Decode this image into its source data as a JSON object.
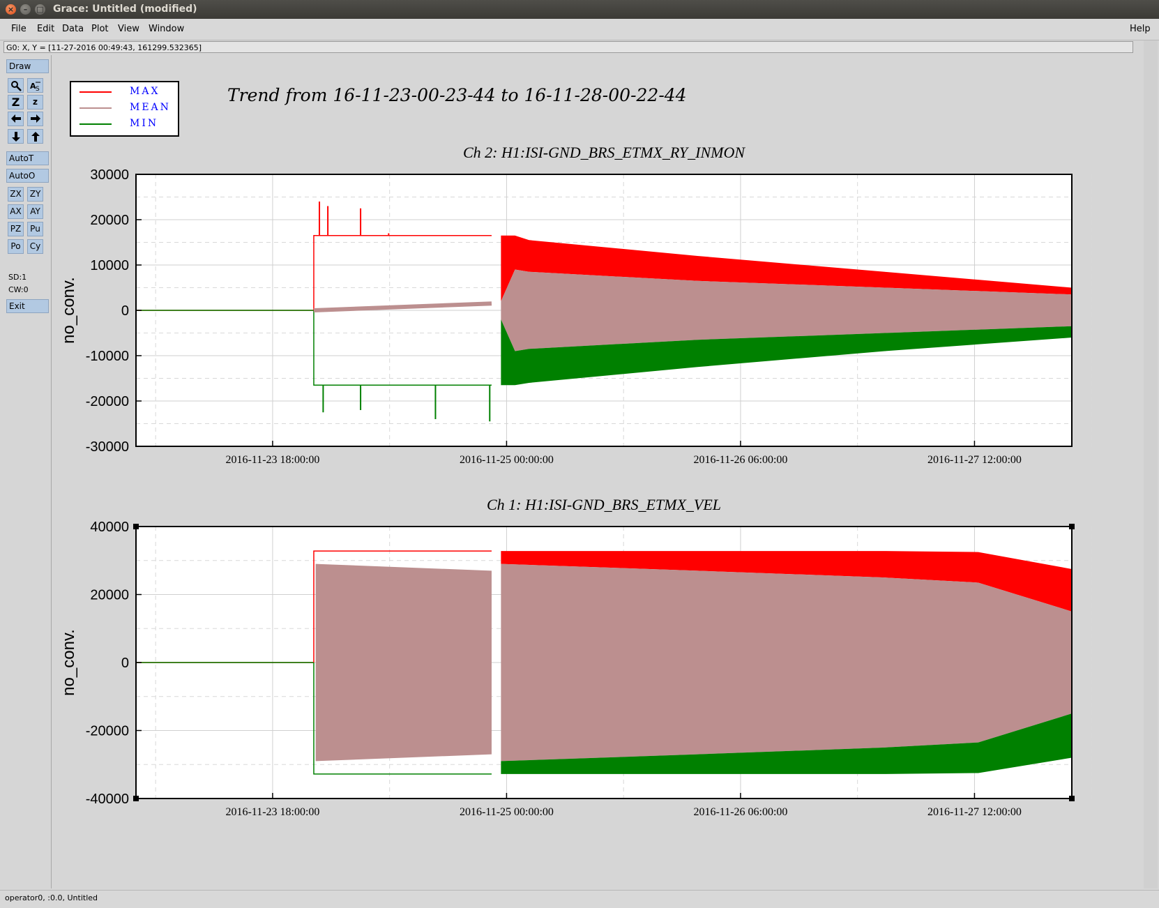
{
  "window": {
    "title": "Grace: Untitled (modified)",
    "close_glyph": "×",
    "min_glyph": "–",
    "max_glyph": "□"
  },
  "menu": {
    "items": [
      "File",
      "Edit",
      "Data",
      "Plot",
      "View",
      "Window"
    ],
    "help": "Help"
  },
  "locator": "G0: X, Y = [11-27-2016 00:49:43, 161299.532365]",
  "toolbox": {
    "draw": "Draw",
    "autot": "AutoT",
    "autoo": "AutoO",
    "zx": "ZX",
    "zy": "ZY",
    "ax": "AX",
    "ay": "AY",
    "pz": "PZ",
    "pu": "Pu",
    "po": "Po",
    "cy": "Cy",
    "zoom_in": "Z",
    "zoom_out": "z",
    "sd": "SD:1",
    "cw": "CW:0",
    "exit": "Exit"
  },
  "status": "operator0, :0.0, Untitled",
  "page_title": "Trend from 16-11-23-00-23-44 to 16-11-28-00-22-44",
  "legend": [
    {
      "label": "MAX",
      "color": "#ff0000"
    },
    {
      "label": "MEAN",
      "color": "#bc8f8f"
    },
    {
      "label": "MIN",
      "color": "#008000"
    }
  ],
  "chart_data": [
    {
      "type": "line",
      "title": "Ch 2: H1:ISI-GND_BRS_ETMX_RY_INMON",
      "ylabel": "no_conv.",
      "xlabel": "",
      "ylim": [
        -30000,
        30000
      ],
      "yticks": [
        "30000",
        "20000",
        "10000",
        "0",
        "-10000",
        "-20000",
        "-30000"
      ],
      "xticks": [
        "2016-11-23 18:00:00",
        "2016-11-25 00:00:00",
        "2016-11-26 06:00:00",
        "2016-11-27 12:00:00"
      ],
      "grid": true,
      "x": [
        0.0,
        0.19,
        0.192,
        0.38,
        0.39,
        0.405,
        0.42,
        0.6,
        0.8,
        1.0
      ],
      "series": [
        {
          "name": "MAX",
          "values": [
            0,
            0,
            16500,
            16500,
            16500,
            16500,
            15500,
            12000,
            8500,
            5000
          ]
        },
        {
          "name": "MEAN",
          "values": [
            0,
            0,
            -500,
            3500,
            2000,
            9000,
            8500,
            6500,
            5000,
            3500
          ]
        },
        {
          "name": "MIN",
          "values": [
            0,
            0,
            -16500,
            -16500,
            -16500,
            -16500,
            -16000,
            -12500,
            -9000,
            -6000
          ]
        }
      ],
      "spikes_max": [
        24000,
        23000,
        22500,
        17000
      ],
      "spikes_min": [
        -22500,
        -22000,
        -24000,
        -24500
      ]
    },
    {
      "type": "line",
      "title": "Ch 1: H1:ISI-GND_BRS_ETMX_VEL",
      "ylabel": "no_conv.",
      "xlabel": "",
      "ylim": [
        -40000,
        40000
      ],
      "yticks": [
        "40000",
        "20000",
        "0",
        "-20000",
        "-40000"
      ],
      "xticks": [
        "2016-11-23 18:00:00",
        "2016-11-25 00:00:00",
        "2016-11-26 06:00:00",
        "2016-11-27 12:00:00"
      ],
      "grid": true,
      "x": [
        0.0,
        0.19,
        0.192,
        0.38,
        0.39,
        0.6,
        0.8,
        0.9,
        1.0
      ],
      "series": [
        {
          "name": "MAX",
          "values": [
            0,
            0,
            32800,
            32800,
            32800,
            32800,
            32800,
            32500,
            27500
          ]
        },
        {
          "name": "MEAN",
          "values": [
            0,
            0,
            29000,
            27000,
            29000,
            27000,
            25000,
            23500,
            15000
          ]
        },
        {
          "name": "MIN",
          "values": [
            0,
            0,
            -32800,
            -32800,
            -32800,
            -32800,
            -32800,
            -32500,
            -28000
          ]
        }
      ]
    }
  ]
}
